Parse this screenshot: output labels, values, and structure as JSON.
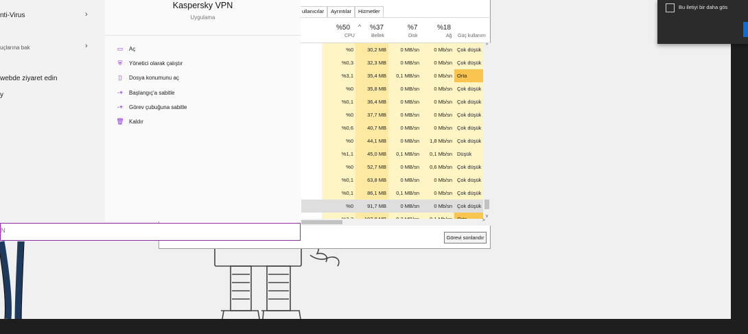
{
  "start_menu": {
    "left_items": [
      {
        "label": "nti-Virus",
        "has_chevron": true
      },
      {
        "label": "uçlarına bak",
        "has_chevron": true
      },
      {
        "label": "webde ziyaret edin",
        "has_chevron": false
      },
      {
        "label": "y",
        "has_chevron": false
      }
    ],
    "app": {
      "title": "Kaspersky VPN",
      "subtitle": "Uygulama"
    },
    "actions": [
      {
        "label": "Aç",
        "icon": "open-icon"
      },
      {
        "label": "Yönetici olarak çalıştır",
        "icon": "admin-run-icon"
      },
      {
        "label": "Dosya konumunu aç",
        "icon": "file-location-icon"
      },
      {
        "label": "Başlangıç'a sabitle",
        "icon": "pin-start-icon"
      },
      {
        "label": "Görev çubuğuna sabitle",
        "icon": "pin-taskbar-icon"
      },
      {
        "label": "Kaldır",
        "icon": "uninstall-icon"
      }
    ],
    "search_value": "N"
  },
  "task_manager": {
    "tabs": [
      "ullanıcılar",
      "Ayrıntılar",
      "Hizmetler"
    ],
    "headers": [
      {
        "pct": "%50",
        "label": "CPU"
      },
      {
        "pct": "%37",
        "label": "Bellek"
      },
      {
        "pct": "%7",
        "label": "Disk"
      },
      {
        "pct": "%18",
        "label": "Ağ"
      },
      {
        "pct": "",
        "label": "Güç kullanım"
      }
    ],
    "rows": [
      {
        "cpu": "%0",
        "mem": "30,2 MB",
        "disk": "0 MB/sn",
        "net": "0 Mb/sn",
        "power": "Çok düşük",
        "level": "low"
      },
      {
        "cpu": "%0,3",
        "mem": "32,3 MB",
        "disk": "0 MB/sn",
        "net": "0 Mb/sn",
        "power": "Çok düşük",
        "level": "low"
      },
      {
        "cpu": "%3,1",
        "mem": "35,4 MB",
        "disk": "0,1 MB/sn",
        "net": "0 Mb/sn",
        "power": "Orta",
        "level": "medium"
      },
      {
        "cpu": "%0",
        "mem": "35,8 MB",
        "disk": "0 MB/sn",
        "net": "0 Mb/sn",
        "power": "Çok düşük",
        "level": "low"
      },
      {
        "cpu": "%0,1",
        "mem": "36,4 MB",
        "disk": "0 MB/sn",
        "net": "0 Mb/sn",
        "power": "Çok düşük",
        "level": "low"
      },
      {
        "cpu": "%0",
        "mem": "37,7 MB",
        "disk": "0 MB/sn",
        "net": "0 Mb/sn",
        "power": "Çok düşük",
        "level": "low"
      },
      {
        "cpu": "%0,6",
        "mem": "40,7 MB",
        "disk": "0 MB/sn",
        "net": "0 Mb/sn",
        "power": "Çok düşük",
        "level": "low"
      },
      {
        "cpu": "%0",
        "mem": "44,1 MB",
        "disk": "0 MB/sn",
        "net": "1,8 Mb/sn",
        "power": "Çok düşük",
        "level": "low"
      },
      {
        "cpu": "%1,1",
        "mem": "45,0 MB",
        "disk": "0,1 MB/sn",
        "net": "0,1 Mb/sn",
        "power": "Düşük",
        "level": "low"
      },
      {
        "cpu": "%0",
        "mem": "52,7 MB",
        "disk": "0 MB/sn",
        "net": "0,6 Mb/sn",
        "power": "Çok düşük",
        "level": "low"
      },
      {
        "cpu": "%0,1",
        "mem": "63,8 MB",
        "disk": "0 MB/sn",
        "net": "0 Mb/sn",
        "power": "Çok düşük",
        "level": "low"
      },
      {
        "cpu": "%0,1",
        "mem": "86,1 MB",
        "disk": "0,1 MB/sn",
        "net": "0 Mb/sn",
        "power": "Çok düşük",
        "level": "low"
      },
      {
        "cpu": "%0",
        "mem": "91,7 MB",
        "disk": "0 MB/sn",
        "net": "0 Mb/sn",
        "power": "Çok düşük",
        "level": "low",
        "selected": true
      },
      {
        "cpu": "%3,2",
        "mem": "107,8 MB",
        "disk": "0,2 MB/sn",
        "net": "0,1 Mb/sn",
        "power": "Orta",
        "level": "medium"
      }
    ],
    "end_task_label": "Görevi sonlandır"
  },
  "notification": {
    "checkbox_label": "Bu iletiyi bir daha gös"
  },
  "colors": {
    "accent_purple": "#8b2fa6",
    "heat_light": "#fff4c4",
    "heat_medium": "#f9c44f",
    "notif_button": "#0a6cd6"
  }
}
